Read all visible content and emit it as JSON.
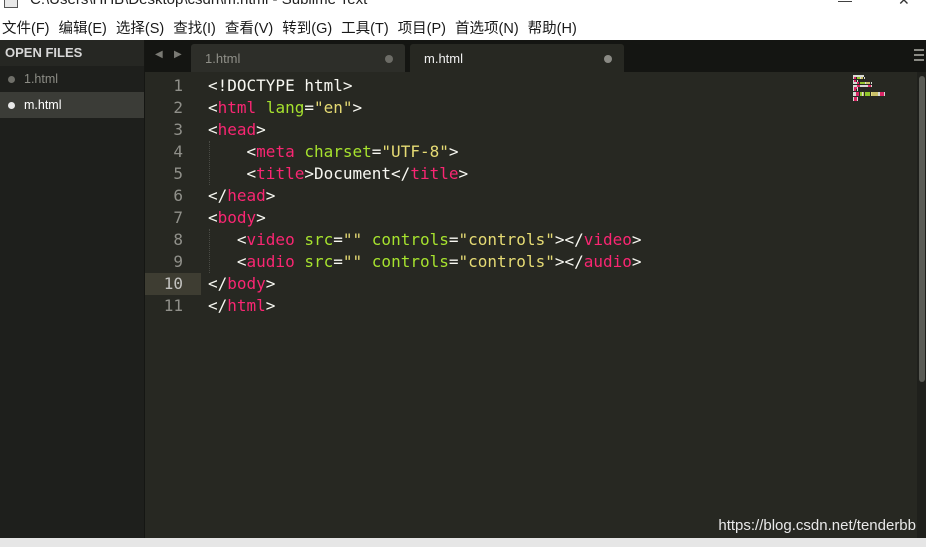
{
  "window": {
    "title": "C:\\Users\\HHB\\Desktop\\csdn\\m.html - Sublime Text"
  },
  "menu": [
    {
      "label": "文件(F)"
    },
    {
      "label": "编辑(E)"
    },
    {
      "label": "选择(S)"
    },
    {
      "label": "查找(I)"
    },
    {
      "label": "查看(V)"
    },
    {
      "label": "转到(G)"
    },
    {
      "label": "工具(T)"
    },
    {
      "label": "项目(P)"
    },
    {
      "label": "首选项(N)"
    },
    {
      "label": "帮助(H)"
    }
  ],
  "sidebar": {
    "heading": "OPEN FILES",
    "files": [
      {
        "name": "1.html",
        "active": false
      },
      {
        "name": "m.html",
        "active": true
      }
    ]
  },
  "tabs": [
    {
      "label": "1.html",
      "active": false
    },
    {
      "label": "m.html",
      "active": true
    }
  ],
  "editor": {
    "current_line": 10,
    "line_numbers": [
      "1",
      "2",
      "3",
      "4",
      "5",
      "6",
      "7",
      "8",
      "9",
      "10",
      "11"
    ],
    "lines": [
      [
        {
          "t": "txt",
          "v": "<!DOCTYPE html>"
        }
      ],
      [
        {
          "t": "txt",
          "v": "<"
        },
        {
          "t": "tag",
          "v": "html"
        },
        {
          "t": "txt",
          "v": " "
        },
        {
          "t": "attr",
          "v": "lang"
        },
        {
          "t": "txt",
          "v": "="
        },
        {
          "t": "str",
          "v": "\"en\""
        },
        {
          "t": "txt",
          "v": ">"
        }
      ],
      [
        {
          "t": "txt",
          "v": "<"
        },
        {
          "t": "tag",
          "v": "head"
        },
        {
          "t": "txt",
          "v": ">"
        }
      ],
      [
        {
          "t": "txt",
          "v": "    <"
        },
        {
          "t": "tag",
          "v": "meta"
        },
        {
          "t": "txt",
          "v": " "
        },
        {
          "t": "attr",
          "v": "charset"
        },
        {
          "t": "txt",
          "v": "="
        },
        {
          "t": "str",
          "v": "\"UTF-8\""
        },
        {
          "t": "txt",
          "v": ">"
        }
      ],
      [
        {
          "t": "txt",
          "v": "    <"
        },
        {
          "t": "tag",
          "v": "title"
        },
        {
          "t": "txt",
          "v": ">Document</"
        },
        {
          "t": "tag",
          "v": "title"
        },
        {
          "t": "txt",
          "v": ">"
        }
      ],
      [
        {
          "t": "txt",
          "v": "</"
        },
        {
          "t": "tag",
          "v": "head"
        },
        {
          "t": "txt",
          "v": ">"
        }
      ],
      [
        {
          "t": "txt",
          "v": "<"
        },
        {
          "t": "tag",
          "v": "body"
        },
        {
          "t": "txt",
          "v": ">"
        }
      ],
      [
        {
          "t": "txt",
          "v": "   <"
        },
        {
          "t": "tag",
          "v": "video"
        },
        {
          "t": "txt",
          "v": " "
        },
        {
          "t": "attr",
          "v": "src"
        },
        {
          "t": "txt",
          "v": "="
        },
        {
          "t": "str",
          "v": "\"\""
        },
        {
          "t": "txt",
          "v": " "
        },
        {
          "t": "attr",
          "v": "controls"
        },
        {
          "t": "txt",
          "v": "="
        },
        {
          "t": "str",
          "v": "\"controls\""
        },
        {
          "t": "txt",
          "v": "></"
        },
        {
          "t": "tag",
          "v": "video"
        },
        {
          "t": "txt",
          "v": ">"
        }
      ],
      [
        {
          "t": "txt",
          "v": "   <"
        },
        {
          "t": "tag",
          "v": "audio"
        },
        {
          "t": "txt",
          "v": " "
        },
        {
          "t": "attr",
          "v": "src"
        },
        {
          "t": "txt",
          "v": "="
        },
        {
          "t": "str",
          "v": "\"\""
        },
        {
          "t": "txt",
          "v": " "
        },
        {
          "t": "attr",
          "v": "controls"
        },
        {
          "t": "txt",
          "v": "="
        },
        {
          "t": "str",
          "v": "\"controls\""
        },
        {
          "t": "txt",
          "v": "></"
        },
        {
          "t": "tag",
          "v": "audio"
        },
        {
          "t": "txt",
          "v": ">"
        }
      ],
      [
        {
          "t": "txt",
          "v": "</"
        },
        {
          "t": "tag",
          "v": "body"
        },
        {
          "t": "txt",
          "v": ">"
        }
      ],
      [
        {
          "t": "txt",
          "v": "</"
        },
        {
          "t": "tag",
          "v": "html"
        },
        {
          "t": "txt",
          "v": ">"
        }
      ]
    ]
  },
  "colors": {
    "background": "#272822",
    "tag": "#f92672",
    "attribute": "#a6e22e",
    "string": "#e6db74",
    "text": "#f8f8f2",
    "gutter_text": "#90908a"
  },
  "icons": {
    "tab_nav_left": "triangle-left-icon",
    "tab_nav_right": "triangle-right-icon",
    "tab_close": "dot-icon",
    "overflow_menu": "hamburger-icon"
  },
  "watermark": "https://blog.csdn.net/tenderbb"
}
